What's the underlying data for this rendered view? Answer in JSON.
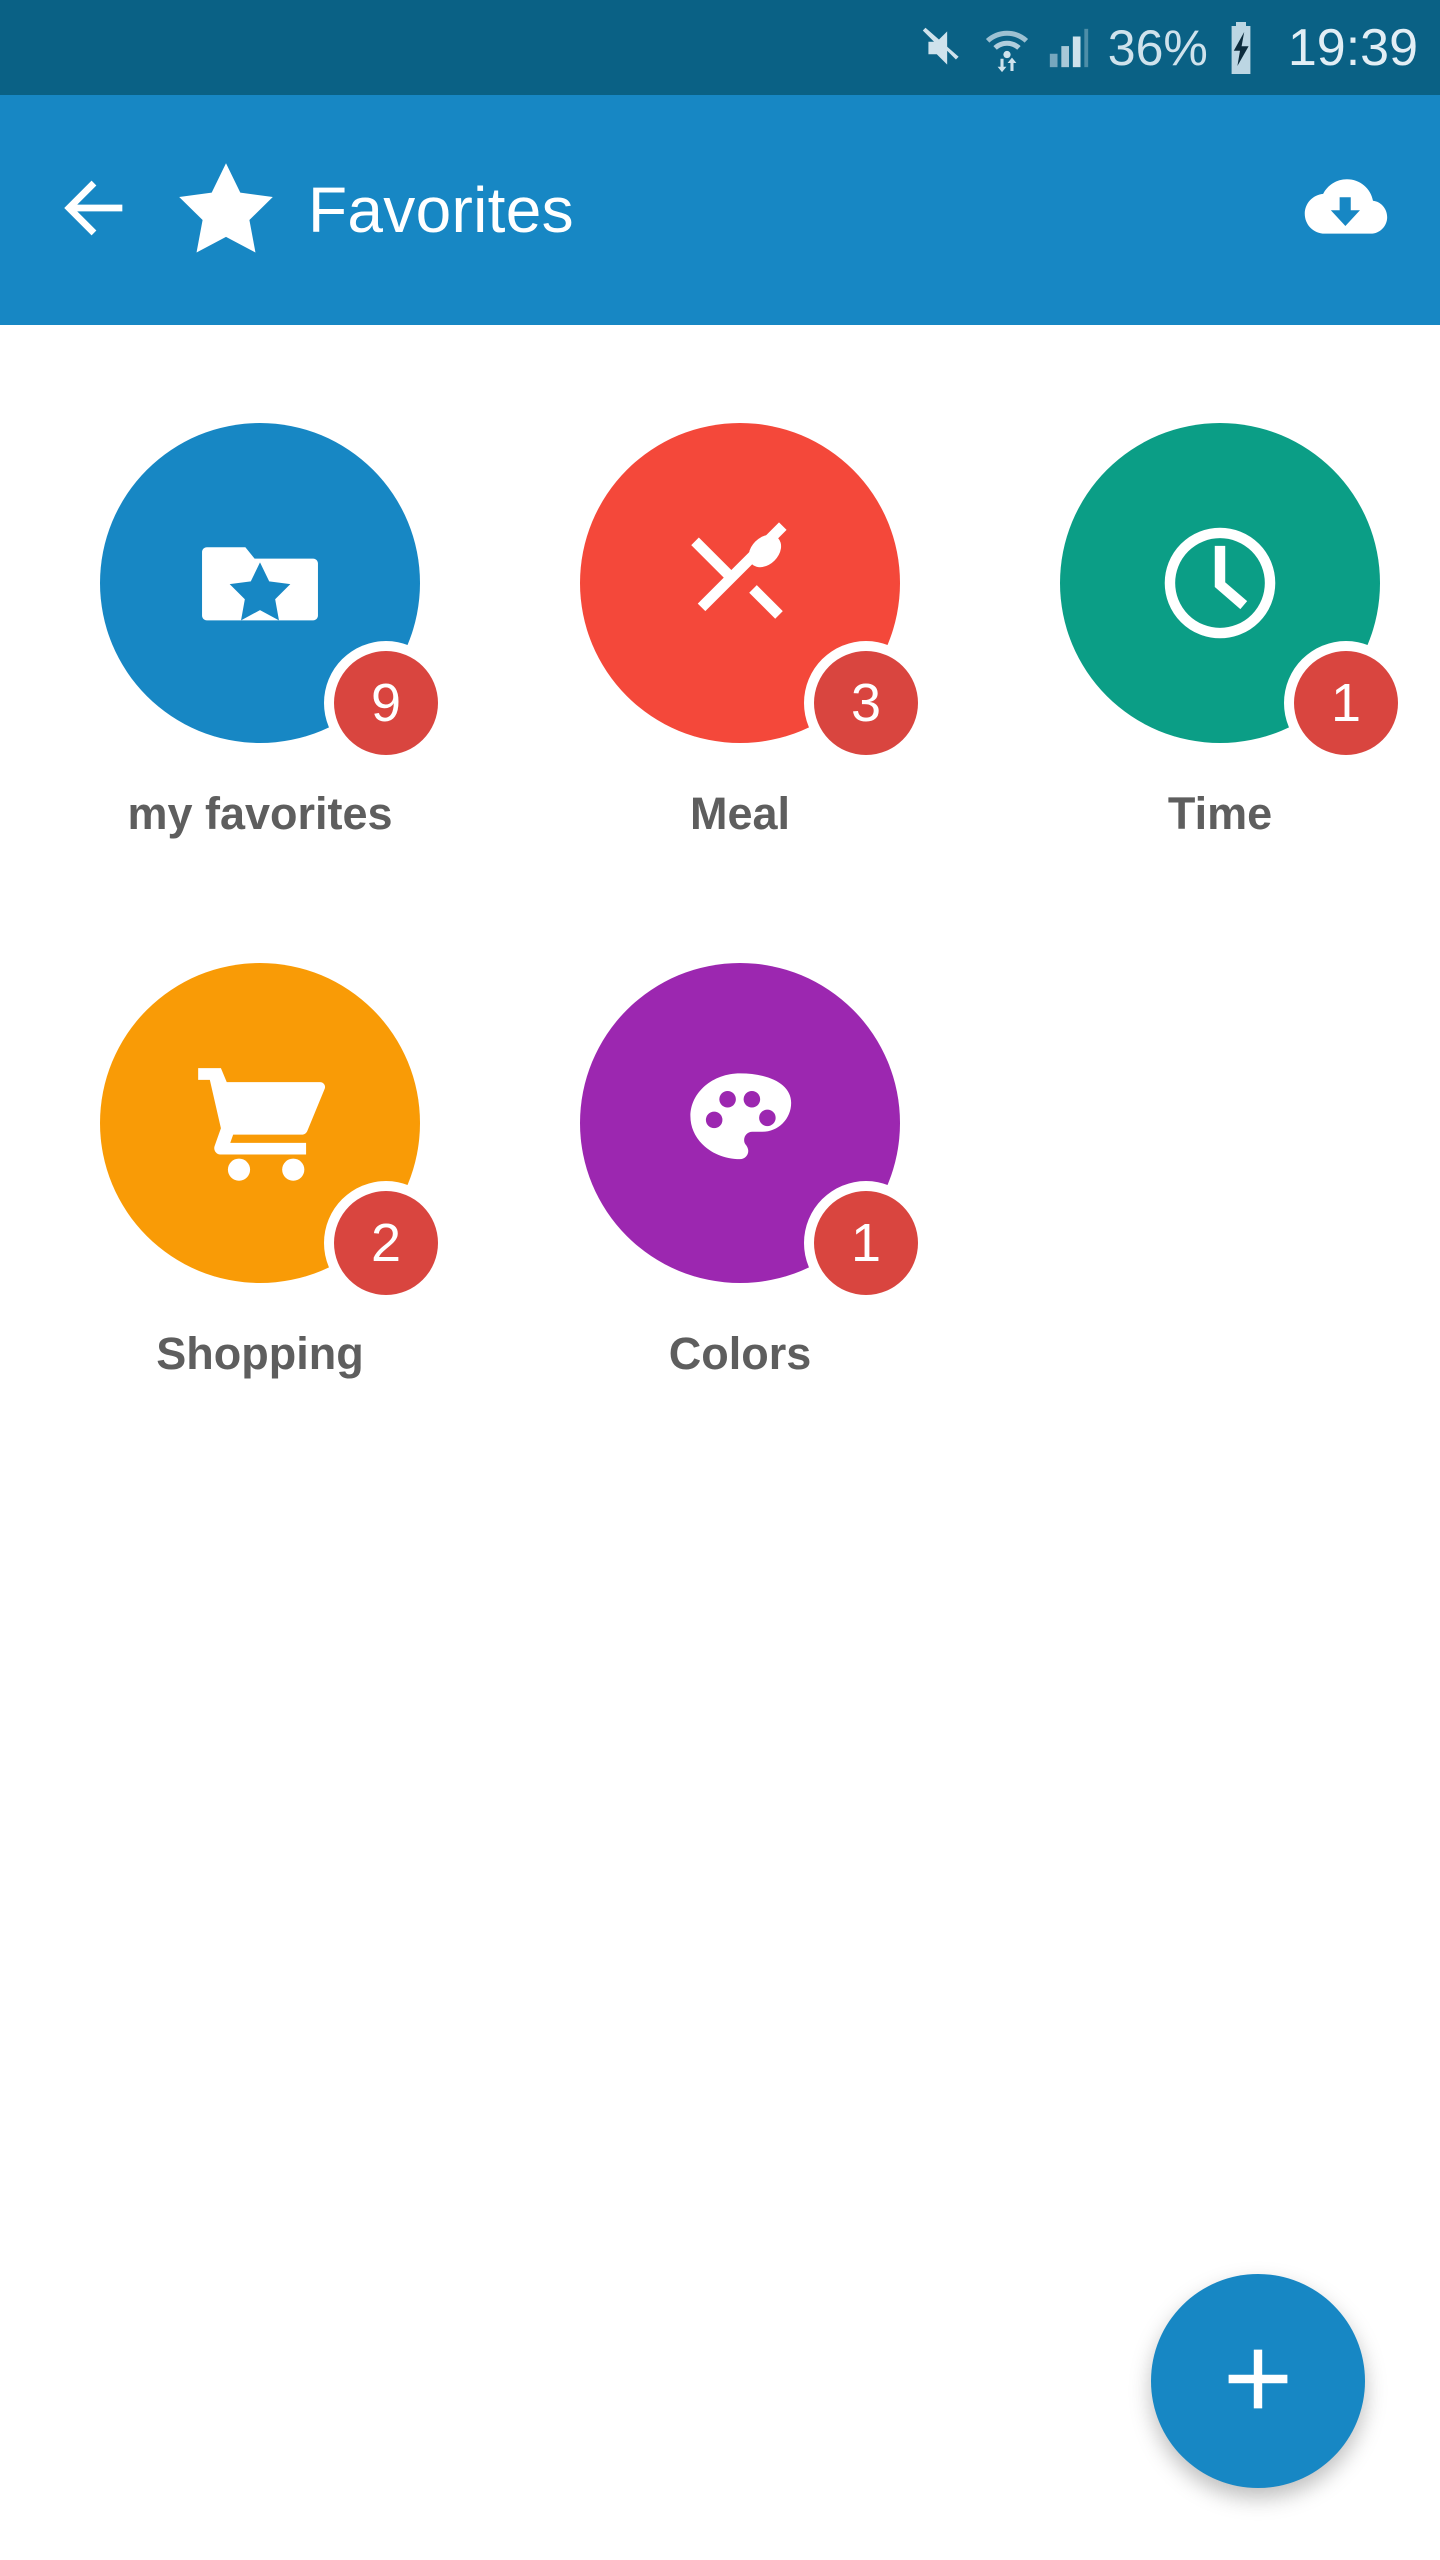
{
  "status_bar": {
    "background": "#0a6185",
    "mute_icon": "mute-icon",
    "wifi_icon": "wifi-transfer-icon",
    "signal_icon": "cellular-signal-icon",
    "battery_percent": "36%",
    "battery_icon": "battery-charging-icon",
    "clock": "19:39"
  },
  "app_bar": {
    "background": "#1787c4",
    "back_icon": "arrow-left-icon",
    "brand_icon": "star-icon",
    "title": "Favorites",
    "action_icon": "cloud-download-icon"
  },
  "grid": {
    "badge_color": "#d9453f",
    "items": [
      {
        "label": "my favorites",
        "badge": "9",
        "color": "#1787c4",
        "icon": "folder-star-icon"
      },
      {
        "label": "Meal",
        "badge": "3",
        "color": "#f4483a",
        "icon": "restaurant-icon"
      },
      {
        "label": "Time",
        "badge": "1",
        "color": "#0b9e86",
        "icon": "clock-icon"
      },
      {
        "label": "Shopping",
        "badge": "2",
        "color": "#f99b06",
        "icon": "shopping-cart-icon"
      },
      {
        "label": "Colors",
        "badge": "1",
        "color": "#9c27b0",
        "icon": "palette-icon"
      }
    ]
  },
  "fab": {
    "label": "+",
    "icon": "plus-icon",
    "color": "#1787c4"
  }
}
